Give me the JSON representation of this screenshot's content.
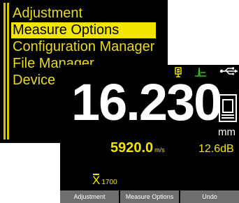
{
  "menu": {
    "items": [
      {
        "label": "Adjustment"
      },
      {
        "label": "Measure Options",
        "selected": true
      },
      {
        "label": "Configuration Manager"
      },
      {
        "label": "File Manager"
      },
      {
        "label": "Device"
      }
    ]
  },
  "display": {
    "thickness": "16.230",
    "unit": "mm",
    "velocity": "5920.0",
    "velocity_unit": "m/s",
    "gain": "12.6dB",
    "xbar_symbol": "X",
    "xbar_subscript": "1700",
    "status_icons": [
      "battery-icon",
      "gate-icon",
      "usb-icon"
    ],
    "probe_icon": "probe-icon"
  },
  "softkeys": [
    {
      "label": "Adjustment"
    },
    {
      "label": "Measure Options"
    },
    {
      "label": "Undo"
    }
  ],
  "colors": {
    "accent_yellow": "#f2e600",
    "background": "#000000",
    "text_white": "#ffffff",
    "gate_green": "#36c21c",
    "softkey_gray": "#6e6e6e"
  }
}
